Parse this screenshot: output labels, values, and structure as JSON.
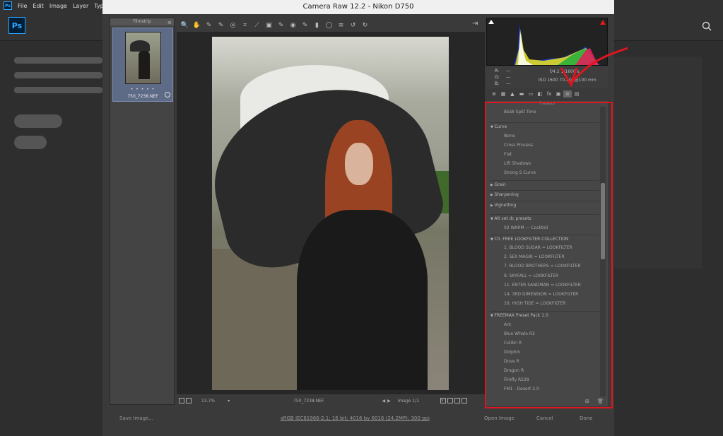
{
  "ps": {
    "logo_small": "Ps",
    "logo_big": "Ps",
    "menu": [
      "File",
      "Edit",
      "Image",
      "Layer",
      "Type"
    ]
  },
  "cr": {
    "window_title": "Camera Raw 12.2  -  Nikon D750",
    "filmstrip": {
      "header": "Filmstrip",
      "menu_glyph": "≡",
      "stars": "• • • • •",
      "filename": "750_7238.NEF"
    },
    "toolbar_icons": [
      "zoom-icon",
      "hand-icon",
      "white-balance-icon",
      "color-sampler-icon",
      "target-adjust-icon",
      "crop-icon",
      "straighten-icon",
      "transform-icon",
      "spot-removal-icon",
      "red-eye-icon",
      "adjustment-brush-icon",
      "graduated-filter-icon",
      "radial-filter-icon",
      "preferences-icon",
      "rotate-left-icon",
      "rotate-right-icon"
    ],
    "toolbar_glyphs": [
      "🔍",
      "✋",
      "✎",
      "✎",
      "◎",
      "⌗",
      "⟋",
      "▣",
      "✎",
      "◉",
      "✎",
      "▮",
      "◯",
      "≡",
      "↺",
      "↻"
    ],
    "readout": {
      "r_label": "R:",
      "g_label": "G:",
      "b_label": "B:",
      "r_val": "---",
      "g_val": "---",
      "b_val": "---",
      "info_line1": "f/4.2    1/1600 s",
      "info_line2": "ISO 1600     70-200@100 mm"
    },
    "panel_tabs": [
      "⊛",
      "▦",
      "▲",
      "▬",
      "▭",
      "◧",
      "fx",
      "▣",
      "≡",
      "▤"
    ],
    "presets": {
      "title": "Presets",
      "rows": [
        {
          "type": "item",
          "label": "B&W Split Tone"
        },
        {
          "type": "group",
          "label": "Curve",
          "open": true
        },
        {
          "type": "item",
          "label": "None"
        },
        {
          "type": "item",
          "label": "Cross Process"
        },
        {
          "type": "item",
          "label": "Flat"
        },
        {
          "type": "item",
          "label": "Lift Shadows"
        },
        {
          "type": "item",
          "label": "Strong S Curve"
        },
        {
          "type": "group",
          "label": "Grain",
          "open": false
        },
        {
          "type": "group",
          "label": "Sharpening",
          "open": false
        },
        {
          "type": "group",
          "label": "Vignetting",
          "open": false
        },
        {
          "type": "group",
          "label": "Alt set dc presets",
          "open": true
        },
        {
          "type": "item",
          "label": "02 WARM — Cocktail"
        },
        {
          "type": "group",
          "label": "C0. FREE LOOKFILTER COLLECTION",
          "open": true
        },
        {
          "type": "item",
          "label": "1. BLOOD SUGAR = LOOKFILTER"
        },
        {
          "type": "item",
          "label": "2. SEX MAGIK = LOOKFILTER"
        },
        {
          "type": "item",
          "label": "7. BLOOD BROTHERS = LOOKFILTER"
        },
        {
          "type": "item",
          "label": "9. SKYFALL = LOOKFILTER"
        },
        {
          "type": "item",
          "label": "11. ENTER SANDMAN = LOOKFILTER"
        },
        {
          "type": "item",
          "label": "14. 3RD DIMENSION = LOOKFILTER"
        },
        {
          "type": "item",
          "label": "16. HIGH TIDE = LOOKFILTER"
        },
        {
          "type": "group",
          "label": "FREEMAX Preset Pack 1.0",
          "open": true
        },
        {
          "type": "item",
          "label": "Ant"
        },
        {
          "type": "item",
          "label": "Blue Whale R2"
        },
        {
          "type": "item",
          "label": "Colibri R"
        },
        {
          "type": "item",
          "label": "Dolphin"
        },
        {
          "type": "item",
          "label": "Dove R"
        },
        {
          "type": "item",
          "label": "Dragon R"
        },
        {
          "type": "item",
          "label": "Firefly R228"
        },
        {
          "type": "item",
          "label": "FM1 - Desert 2.0"
        }
      ],
      "new_glyph": "⊞",
      "delete_glyph": "🗑"
    },
    "status": {
      "zoom": "13.7%",
      "zoom_arrow": "▾",
      "filename": "750_7238.NEF",
      "nav_prev": "◀",
      "nav_next": "▶",
      "image_count": "Image 1/1",
      "glyph_y": "Y"
    },
    "footer": {
      "save": "Save Image...",
      "workflow": "sRGB IEC61966-2.1; 16 bit; 4016 by 6016 (24.2MP); 300 ppi",
      "open": "Open Image",
      "cancel": "Cancel",
      "done": "Done"
    }
  }
}
